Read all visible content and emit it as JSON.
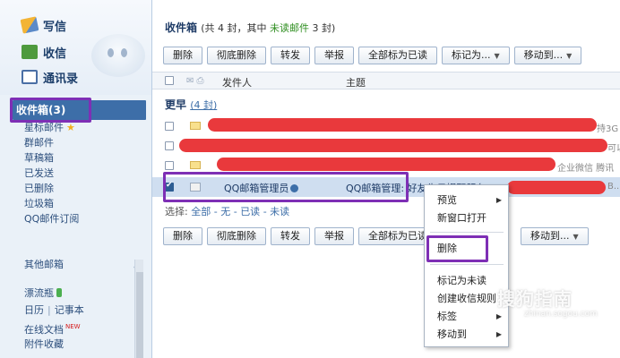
{
  "quick": {
    "write": "写信",
    "receive": "收信",
    "contacts": "通讯录"
  },
  "folders": {
    "inbox": "收件箱(3)",
    "starred": "星标邮件",
    "group": "群邮件",
    "drafts": "草稿箱",
    "sent": "已发送",
    "deleted": "已删除",
    "spam": "垃圾箱",
    "subscriptions": "QQ邮件订阅"
  },
  "other_mailboxes": "其他邮箱",
  "apps": {
    "drift_bottle": "漂流瓶",
    "calendar": "日历",
    "notepad": "记事本",
    "online_docs": "在线文档",
    "new_badge": "NEW",
    "attachments": "附件收藏"
  },
  "main": {
    "title": "收件箱",
    "summary_prefix": "(共 4 封，其中 ",
    "unread_link": "未读邮件",
    "summary_suffix": " 3 封)"
  },
  "toolbar": {
    "delete": "删除",
    "delete_permanent": "彻底删除",
    "forward": "转发",
    "report": "举报",
    "mark_all_read": "全部标为已读",
    "mark_as": "标记为...",
    "move_to": "移动到...",
    "mark_all_read_truncated": "全部标为已读"
  },
  "list_header": {
    "sender": "发件人",
    "subject": "主题"
  },
  "group": {
    "title": "更早",
    "count": "(4 封)"
  },
  "rows": [
    {
      "tail": "持3G"
    },
    {
      "tail": "可以"
    },
    {
      "tail": "企业微信 腾讯"
    },
    {
      "sender": "QQ邮箱管理员",
      "subject": "QQ邮箱管理: 好友生日提醒服务",
      "tail": "B..."
    }
  ],
  "selection": {
    "label": "选择:",
    "all": "全部",
    "none": "无",
    "read": "已读",
    "unread": "未读",
    "dash": "-"
  },
  "context_menu": {
    "preview": "预览",
    "open_new_window": "新窗口打开",
    "delete": "删除",
    "mark_unread": "标记为未读",
    "create_rule": "创建收信规则",
    "tags": "标签",
    "move_to": "移动到"
  },
  "watermark": {
    "text": "搜狗指南",
    "url": "zhinan.sogou.com"
  },
  "colors": {
    "accent": "#3d6ea8",
    "highlight_outline": "#7e2fb5",
    "redaction": "#e9393c",
    "unread_green": "#2f8e20"
  }
}
